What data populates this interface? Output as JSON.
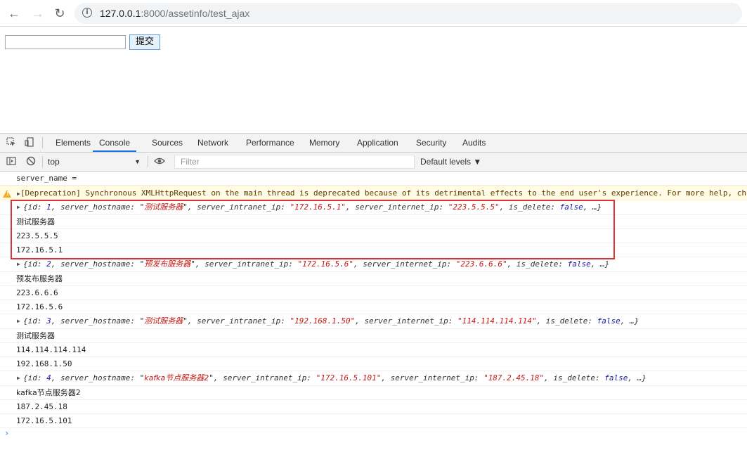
{
  "browser": {
    "url_host": "127.0.0.1",
    "url_path": ":8000/assetinfo/test_ajax",
    "back_icon": "arrow-left-icon",
    "forward_icon": "arrow-right-icon",
    "reload_icon": "reload-icon",
    "info_icon": "info-icon"
  },
  "page": {
    "input_value": "",
    "submit_label": "提交"
  },
  "devtools": {
    "tabs": [
      "Elements",
      "Console",
      "Sources",
      "Network",
      "Performance",
      "Memory",
      "Application",
      "Security",
      "Audits"
    ],
    "active_tab": "Console",
    "context": "top",
    "filter_placeholder": "Filter",
    "levels_label": "Default levels ▼"
  },
  "console": {
    "line0": "server_name =",
    "warning": "[Deprecation] Synchronous XMLHttpRequest on the main thread is deprecated because of its detrimental effects to the end user's experience. For more help, ch",
    "records": [
      {
        "id": "1",
        "hostname": "测试服务器",
        "intranet_ip": "172.16.5.1",
        "internet_ip": "223.5.5.5",
        "is_delete": "false",
        "log_hostname": "测试服务器",
        "log_internet": "223.5.5.5",
        "log_intranet": "172.16.5.1"
      },
      {
        "id": "2",
        "hostname": "预发布服务器",
        "intranet_ip": "172.16.5.6",
        "internet_ip": "223.6.6.6",
        "is_delete": "false",
        "log_hostname": "预发布服务器",
        "log_internet": "223.6.6.6",
        "log_intranet": "172.16.5.6"
      },
      {
        "id": "3",
        "hostname": "测试服务器",
        "intranet_ip": "192.168.1.50",
        "internet_ip": "114.114.114.114",
        "is_delete": "false",
        "log_hostname": "测试服务器",
        "log_internet": "114.114.114.114",
        "log_intranet": "192.168.1.50"
      },
      {
        "id": "4",
        "hostname": "kafka节点服务器2",
        "intranet_ip": "172.16.5.101",
        "internet_ip": "187.2.45.18",
        "is_delete": "false",
        "log_hostname": "kafka节点服务器2",
        "log_internet": "187.2.45.18",
        "log_intranet": "172.16.5.101"
      }
    ],
    "prompt": "›"
  },
  "colors": {
    "highlight": "#e03131",
    "string": "#c41a16",
    "keyword": "#1a1aa6",
    "warning_bg": "#fffbe5"
  }
}
